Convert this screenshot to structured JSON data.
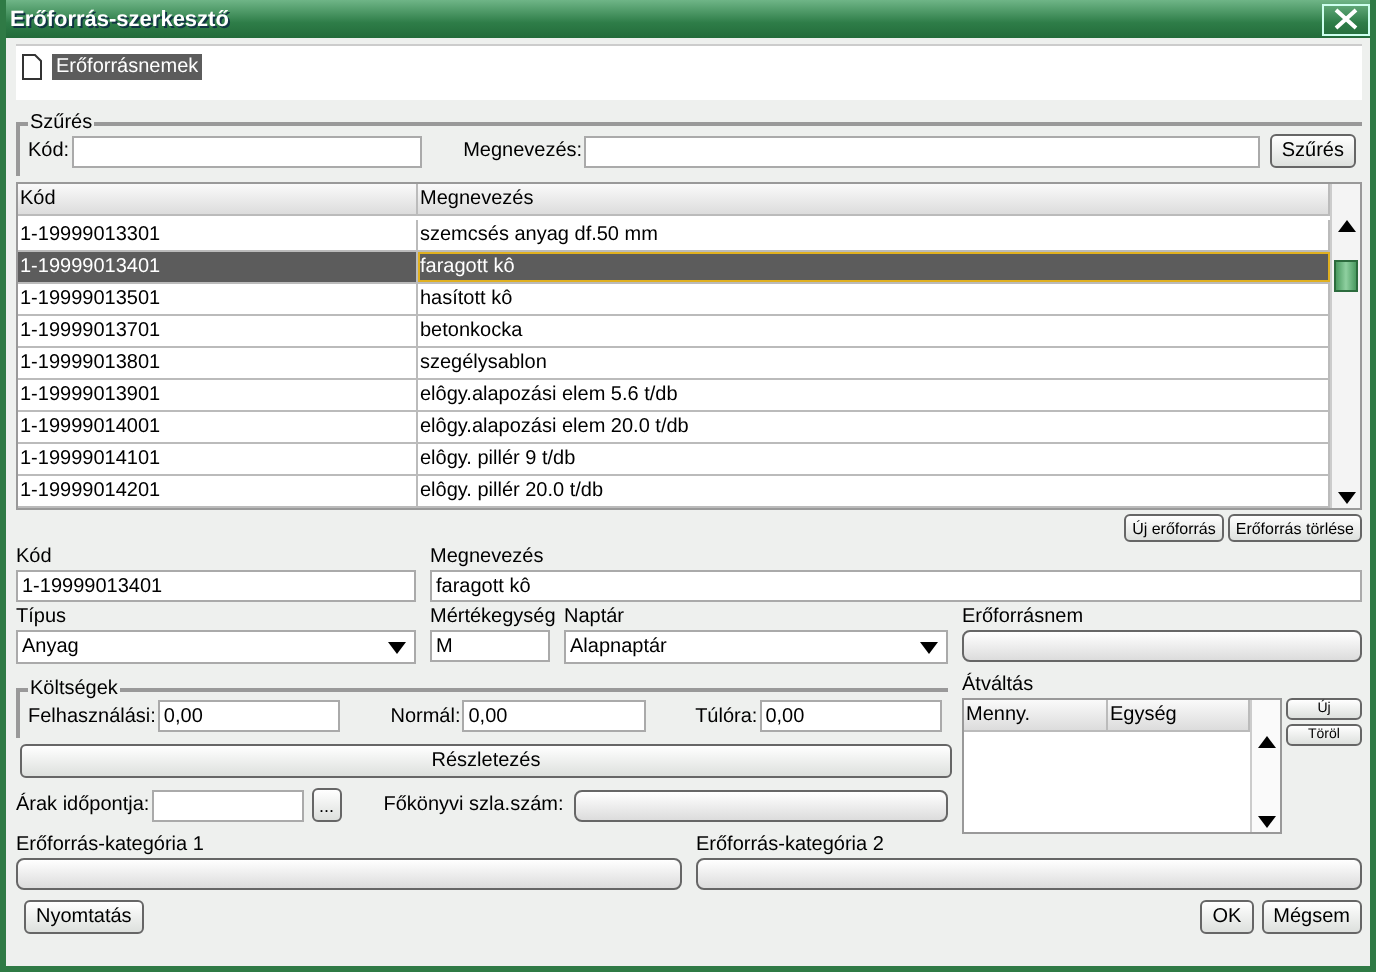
{
  "window": {
    "title": "Erőforrás-szerkesztő"
  },
  "tree": {
    "items": [
      {
        "label": "Erőforrásnemek",
        "selected": true
      }
    ]
  },
  "filter": {
    "title": "Szűrés",
    "code_label": "Kód:",
    "name_label": "Megnevezés:",
    "button": "Szűrés"
  },
  "table": {
    "columns": [
      "Kód",
      "Megnevezés"
    ],
    "rows": [
      {
        "code": "1-19999013301",
        "name": "szemcsés anyag df.50 mm",
        "selected": false
      },
      {
        "code": "1-19999013401",
        "name": "faragott kô",
        "selected": true
      },
      {
        "code": "1-19999013501",
        "name": "hasított kô",
        "selected": false
      },
      {
        "code": "1-19999013701",
        "name": "betonkocka",
        "selected": false
      },
      {
        "code": "1-19999013801",
        "name": "szegélysablon",
        "selected": false
      },
      {
        "code": "1-19999013901",
        "name": "elôgy.alapozási elem 5.6 t/db",
        "selected": false
      },
      {
        "code": "1-19999014001",
        "name": "elôgy.alapozási elem 20.0 t/db",
        "selected": false
      },
      {
        "code": "1-19999014101",
        "name": "elôgy. pillér 9 t/db",
        "selected": false
      },
      {
        "code": "1-19999014201",
        "name": "elôgy. pillér 20.0 t/db",
        "selected": false
      }
    ]
  },
  "table_buttons": [
    "Új erőforrás",
    "Erőforrás törlése"
  ],
  "form": {
    "code": {
      "label": "Kód",
      "value": "1-19999013401"
    },
    "name": {
      "label": "Megnevezés",
      "value": "faragott kô"
    },
    "type": {
      "label": "Típus",
      "value": "Anyag"
    },
    "unit": {
      "label": "Mértékegység",
      "value": "M"
    },
    "calendar": {
      "label": "Naptár",
      "value": "Alapnaptár"
    },
    "resource_type": {
      "label": "Erőforrásnem"
    },
    "costs": {
      "title": "Költségek",
      "fields": [
        {
          "label": "Felhasználási:",
          "value": "0,00"
        },
        {
          "label": "Normál:",
          "value": "0,00"
        },
        {
          "label": "Túlóra:",
          "value": "0,00"
        }
      ]
    },
    "details_button": "Részletezés",
    "price_date": {
      "label": "Árak időpontja:",
      "button": "..."
    },
    "ledger": {
      "label": "Főkönyvi szla.szám:"
    },
    "conversion": {
      "title": "Átváltás",
      "columns": [
        "Menny.",
        "Egység"
      ],
      "buttons": [
        "Új",
        "Töröl"
      ]
    },
    "category1": {
      "label": "Erőforrás-kategória 1"
    },
    "category2": {
      "label": "Erőforrás-kategória 2"
    }
  },
  "footer": {
    "print": "Nyomtatás",
    "ok": "OK",
    "cancel": "Mégsem"
  }
}
